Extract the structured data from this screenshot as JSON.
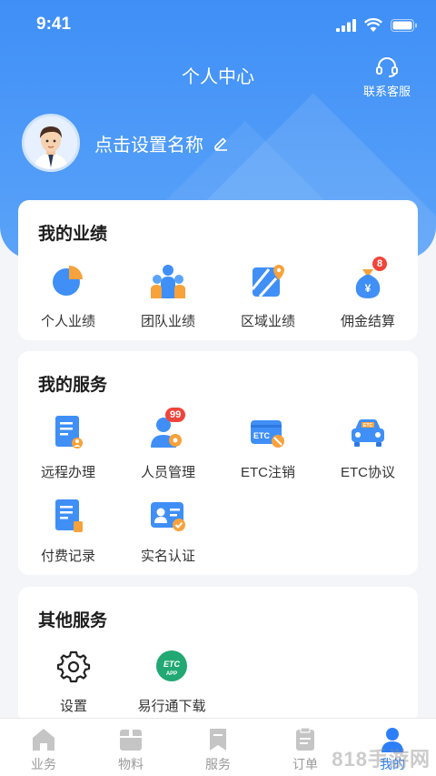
{
  "status_bar": {
    "time": "9:41"
  },
  "header": {
    "title": "个人中心",
    "service_label": "联系客服"
  },
  "profile": {
    "name": "点击设置名称"
  },
  "performance": {
    "title": "我的业绩",
    "items": [
      {
        "label": "个人业绩",
        "icon": "pie-chart-icon"
      },
      {
        "label": "团队业绩",
        "icon": "team-icon"
      },
      {
        "label": "区域业绩",
        "icon": "map-icon"
      },
      {
        "label": "佣金结算",
        "icon": "money-bag-icon",
        "badge": "8"
      }
    ]
  },
  "services": {
    "title": "我的服务",
    "items": [
      {
        "label": "远程办理",
        "icon": "remote-doc-icon"
      },
      {
        "label": "人员管理",
        "icon": "staff-icon",
        "badge": "99"
      },
      {
        "label": "ETC注销",
        "icon": "etc-card-icon"
      },
      {
        "label": "ETC协议",
        "icon": "etc-car-icon"
      },
      {
        "label": "付费记录",
        "icon": "payment-record-icon"
      },
      {
        "label": "实名认证",
        "icon": "id-verify-icon"
      }
    ]
  },
  "other": {
    "title": "其他服务",
    "items": [
      {
        "label": "设置",
        "icon": "gear-icon"
      },
      {
        "label": "易行通下载",
        "icon": "etc-app-icon",
        "logo_text": "ETC",
        "logo_sub": "APP"
      }
    ]
  },
  "tabbar": {
    "items": [
      {
        "label": "业务",
        "active": false
      },
      {
        "label": "物料",
        "active": false
      },
      {
        "label": "服务",
        "active": false
      },
      {
        "label": "订单",
        "active": false
      },
      {
        "label": "我的",
        "active": true
      }
    ]
  },
  "watermark": "818手游网",
  "colors": {
    "primary": "#3f8ff7",
    "active_tab": "#2d7ff9",
    "badge": "#f0453a",
    "orange": "#f7a23b"
  }
}
